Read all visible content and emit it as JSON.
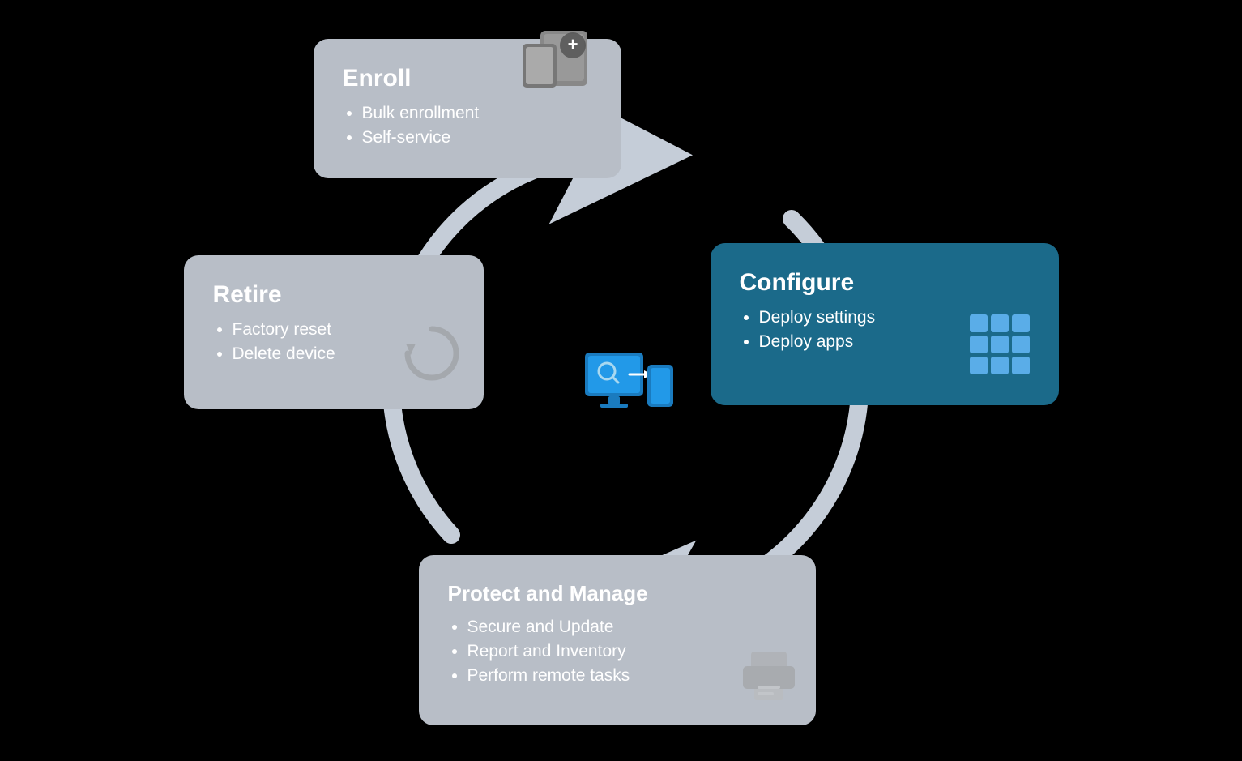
{
  "enroll": {
    "title": "Enroll",
    "items": [
      "Bulk enrollment",
      "Self-service"
    ]
  },
  "retire": {
    "title": "Retire",
    "items": [
      "Factory reset",
      "Delete device"
    ]
  },
  "configure": {
    "title": "Configure",
    "items": [
      "Deploy settings",
      "Deploy apps"
    ]
  },
  "protect": {
    "title": "Protect and Manage",
    "items": [
      "Secure and Update",
      "Report and Inventory",
      "Perform remote tasks"
    ]
  }
}
